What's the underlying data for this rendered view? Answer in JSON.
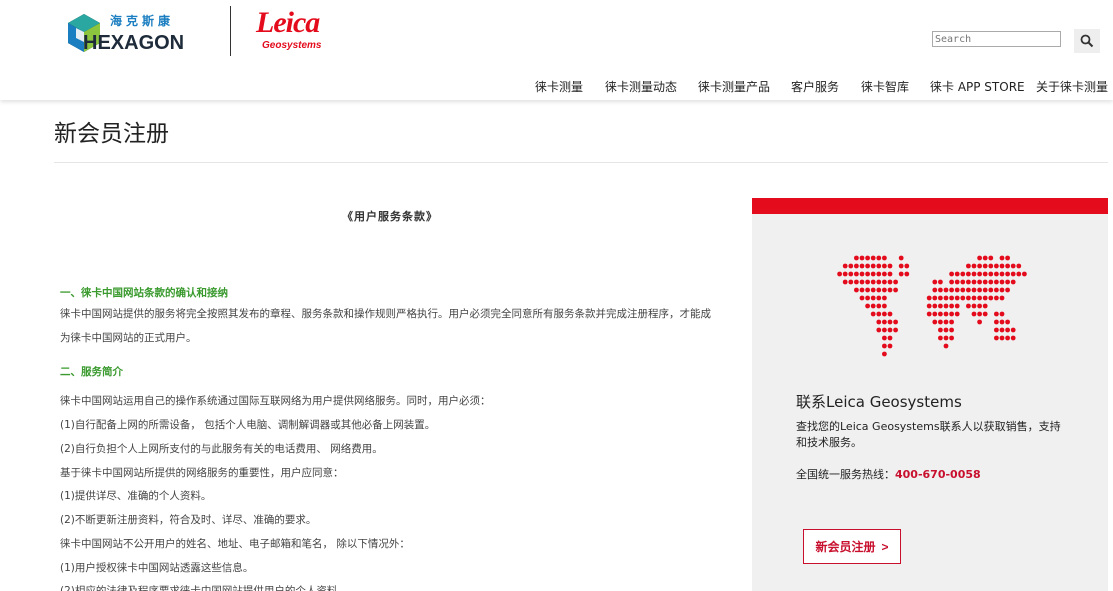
{
  "brand": {
    "hexagon_cn": "海克斯康",
    "hexagon_en": "HEXAGON",
    "leica_word": "Leica",
    "leica_sub": "Geosystems",
    "accent": "#e30b1c"
  },
  "search": {
    "placeholder": "Search"
  },
  "nav": [
    "徕卡测量",
    "徕卡测量动态",
    "徕卡测量产品",
    "客户服务",
    "徕卡智库",
    "徕卡 APP STORE",
    "关于徕卡测量"
  ],
  "page_title": "新会员注册",
  "terms": {
    "heading": "《用户服务条款》",
    "section1_title": "一、徕卡中国网站条款的确认和接纳",
    "section1_text": "徕卡中国网站提供的服务将完全按照其发布的章程、服务条款和操作规则严格执行。用户必须完全同意所有服务条款并完成注册程序，才能成为徕卡中国网站的正式用户。",
    "section2_title": "二、服务简介",
    "lines": [
      "徕卡中国网站运用自己的操作系统通过国际互联网络为用户提供网络服务。同时，用户必须：",
      "(1)自行配备上网的所需设备， 包括个人电脑、调制解调器或其他必备上网装置。",
      "(2)自行负担个人上网所支付的与此服务有关的电话费用、 网络费用。",
      "基于徕卡中国网站所提供的网络服务的重要性，用户应同意：",
      "(1)提供详尽、准确的个人资料。",
      "(2)不断更新注册资料，符合及时、详尽、准确的要求。",
      "徕卡中国网站不公开用户的姓名、地址、电子邮箱和笔名， 除以下情况外：",
      "(1)用户授权徕卡中国网站透露这些信息。",
      "(2)相应的法律及程序要求徕卡中国网站提供用户的个人资料。"
    ]
  },
  "sidebar": {
    "title": "联系Leica Geosystems",
    "desc": "查找您的Leica Geosystems联系人以获取销售，支持和技术服务。",
    "hotline_label": "全国统一服务热线：",
    "hotline_number": "400-670-0058",
    "button_label": "新会员注册",
    "button_arrow": ">"
  },
  "icons": [
    "search-icon",
    "world-map-icon",
    "hexagon-cube-icon"
  ]
}
